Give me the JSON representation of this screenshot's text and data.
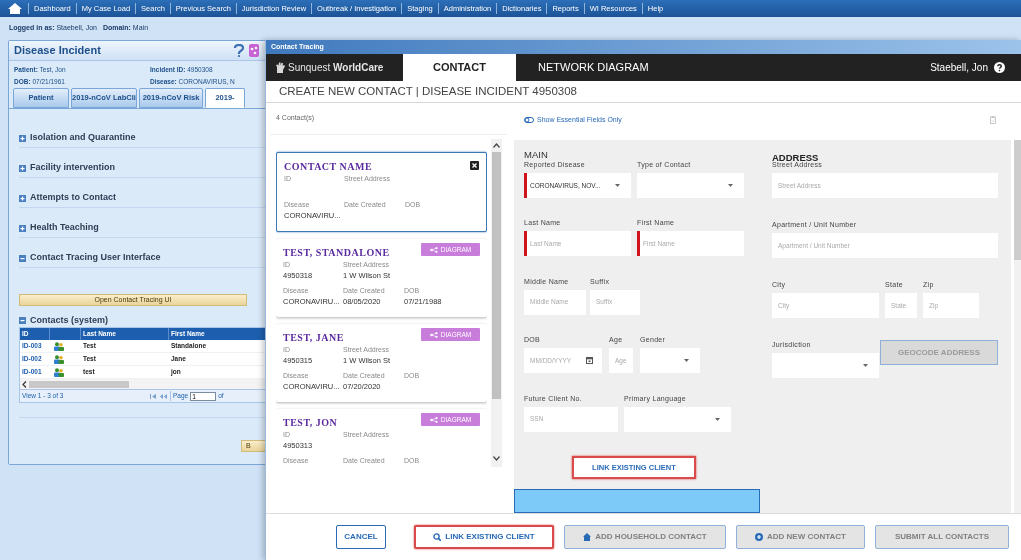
{
  "nav": {
    "items": [
      "Dashboard",
      "My Case Load",
      "Search",
      "Previous Search",
      "Jurisdiction Review",
      "Outbreak / Investigation",
      "Staging",
      "Administration",
      "Dictionaries",
      "Reports",
      "WI Resources",
      "Help"
    ]
  },
  "session": {
    "user_label": "Logged in as:",
    "user": "Staebell, Jon",
    "domain_label": "Domain:",
    "domain": "Main"
  },
  "incident_panel": {
    "title": "Disease Incident",
    "info": [
      {
        "label": "Patient:",
        "value": "Test, Jon"
      },
      {
        "label": "Incident ID:",
        "value": "4950308"
      },
      {
        "label": "DOB:",
        "value": "07/21/1961"
      },
      {
        "label": "Disease:",
        "value": "CORONAVIRUS, N"
      }
    ],
    "tabs": [
      {
        "label": "Patient",
        "selected": false
      },
      {
        "label": "2019-nCoV LabCli",
        "selected": false
      },
      {
        "label": "2019-nCoV Risk",
        "selected": false
      },
      {
        "label": "2019-",
        "selected": true
      }
    ],
    "sections": [
      {
        "title": "Isolation and Quarantine",
        "expanded": false,
        "kind": "plain"
      },
      {
        "title": "Facility intervention",
        "expanded": false,
        "kind": "plain"
      },
      {
        "title": "Attempts to Contact",
        "expanded": false,
        "kind": "plain"
      },
      {
        "title": "Health Teaching",
        "expanded": false,
        "kind": "plain"
      },
      {
        "title": "Contact Tracing User Interface",
        "expanded": true,
        "kind": "button",
        "button": "Open Contact Tracing UI"
      },
      {
        "title": "Contacts (system)",
        "expanded": true,
        "kind": "table"
      }
    ],
    "contacts_table": {
      "columns": [
        "ID",
        "Last Name",
        "First Name"
      ],
      "rows": [
        {
          "id": "ID-003",
          "last_name": "Test",
          "first_name": "Standalone"
        },
        {
          "id": "ID-002",
          "last_name": "Test",
          "first_name": "Jane"
        },
        {
          "id": "ID-001",
          "last_name": "test",
          "first_name": "jon"
        }
      ],
      "footer": "View 1 - 3 of 3",
      "page_label": "Page",
      "page": "1",
      "page_of": "of"
    },
    "panel_button": "B"
  },
  "modal": {
    "title": "Contact Tracing",
    "brand": "Sunquest **WorldCare**",
    "tabs": [
      {
        "label": "CONTACT",
        "selected": true
      },
      {
        "label": "NETWORK DIAGRAM",
        "selected": false
      }
    ],
    "user": "Staebell, Jon",
    "heading": "CREATE NEW CONTACT | DISEASE INCIDENT 4950308",
    "contact_count": "4 Contact(s)",
    "essential_toggle": {
      "label": "Show Essential Fields Only",
      "on": false
    },
    "contacts": [
      {
        "name": "CONTACT NAME",
        "selected": true,
        "kind": "new",
        "fields": [
          {
            "label": "ID"
          },
          {
            "label": "Street Address"
          },
          {
            "label": "Disease",
            "value": "CORONAVIRU..."
          },
          {
            "label": "Date Created"
          },
          {
            "label": "DOB"
          }
        ]
      },
      {
        "name": "TEST, STANDALONE",
        "selected": false,
        "kind": "existing",
        "button": "DIAGRAM",
        "fields": [
          {
            "label": "ID",
            "value": "4950318"
          },
          {
            "label": "Street Address",
            "value": "1 W Wilson St"
          },
          {
            "label": "Disease",
            "value": "CORONAVIRU..."
          },
          {
            "label": "Date Created",
            "value": "08/05/2020"
          },
          {
            "label": "DOB",
            "value": "07/21/1988"
          }
        ]
      },
      {
        "name": "TEST, JANE",
        "selected": false,
        "kind": "existing",
        "button": "DIAGRAM",
        "fields": [
          {
            "label": "ID",
            "value": "4950315"
          },
          {
            "label": "Street Address",
            "value": "1 W Wilson St"
          },
          {
            "label": "Disease",
            "value": "CORONAVIRU..."
          },
          {
            "label": "Date Created",
            "value": "07/20/2020"
          },
          {
            "label": "DOB"
          }
        ]
      },
      {
        "name": "TEST, JON",
        "selected": false,
        "kind": "existing",
        "button": "DIAGRAM",
        "fields": [
          {
            "label": "ID",
            "value": "4950313"
          },
          {
            "label": "Street Address"
          },
          {
            "label": "Disease"
          },
          {
            "label": "Date Created"
          },
          {
            "label": "DOB"
          }
        ]
      }
    ],
    "form": {
      "main_title": "MAIN",
      "address_title": "ADDRESS",
      "main_rows": [
        [
          {
            "label": "Reported Disease",
            "kind": "select",
            "value": "CORONAVIRUS, NOV...",
            "required": true
          },
          {
            "label": "Type of Contact",
            "kind": "select",
            "required": false
          }
        ],
        [
          {
            "label": "Last Name",
            "kind": "text",
            "placeholder": "Last Name",
            "required": true
          },
          {
            "label": "First Name",
            "kind": "text",
            "placeholder": "First Name",
            "required": true
          }
        ],
        [
          {
            "label": "Middle Name",
            "kind": "text",
            "placeholder": "Middle Name",
            "required": false
          },
          {
            "label": "Suffix",
            "kind": "text",
            "placeholder": "Suffix",
            "required": false
          }
        ],
        [
          {
            "label": "DOB",
            "kind": "date",
            "placeholder": "MM/DD/YYYY",
            "required": false
          },
          {
            "label": "Age",
            "kind": "text",
            "placeholder": "Age",
            "required": false
          },
          {
            "label": "Gender",
            "kind": "select",
            "required": false
          }
        ],
        [
          {
            "label": "Future Client No.",
            "kind": "text",
            "placeholder": "SSN",
            "required": false
          },
          {
            "label": "Primary Language",
            "kind": "select",
            "required": false
          }
        ]
      ],
      "address_rows": [
        [
          {
            "label": "Street Address",
            "kind": "text",
            "placeholder": "Street Address",
            "required": false
          }
        ],
        [
          {
            "label": "Apartment / Unit Number",
            "kind": "text",
            "placeholder": "Apartment / Unit Number",
            "required": false
          }
        ],
        [
          {
            "label": "City",
            "kind": "text",
            "placeholder": "City",
            "required": false
          },
          {
            "label": "State",
            "kind": "text",
            "placeholder": "State",
            "required": false
          },
          {
            "label": "Zip",
            "kind": "text",
            "placeholder": "Zip",
            "required": false
          }
        ],
        [
          {
            "label": "Jurisdiction",
            "kind": "select",
            "required": false
          }
        ]
      ],
      "geocode_button": {
        "label": "GEOCODE ADDRESS",
        "disabled": true
      },
      "link_button": {
        "label": "LINK EXISTING CLIENT",
        "highlighted": true
      }
    },
    "footer_buttons": [
      {
        "label": "CANCEL",
        "kind": "cancel",
        "disabled": false,
        "highlighted": false
      },
      {
        "label": "LINK EXISTING CLIENT",
        "kind": "search",
        "disabled": false,
        "highlighted": true
      },
      {
        "label": "ADD HOUSEHOLD CONTACT",
        "kind": "home",
        "disabled": true,
        "highlighted": false
      },
      {
        "label": "ADD NEW CONTACT",
        "kind": "add",
        "disabled": true,
        "highlighted": false
      },
      {
        "label": "SUBMIT ALL CONTACTS",
        "kind": "plain",
        "disabled": true,
        "highlighted": false
      }
    ]
  }
}
